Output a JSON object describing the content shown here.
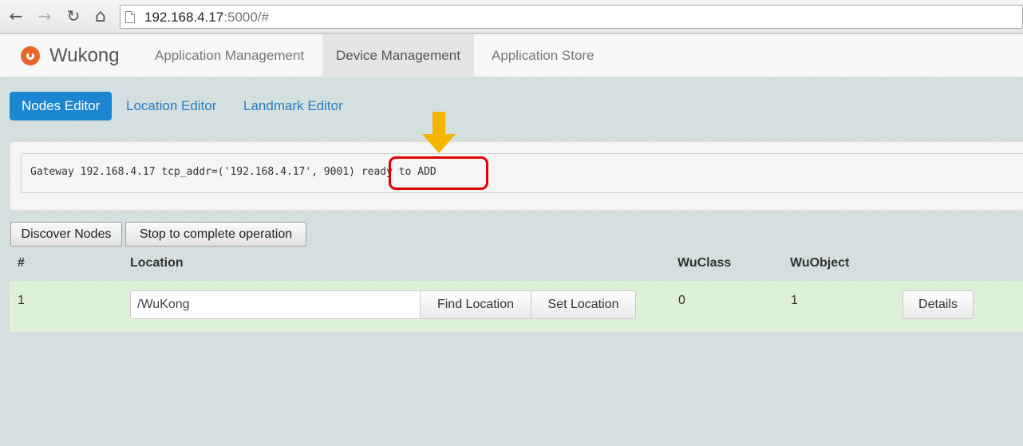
{
  "browser": {
    "url_host": "192.168.4.17",
    "url_rest": ":5000/#",
    "back_icon": "←",
    "forward_icon": "→",
    "reload_icon": "↻",
    "home_icon": "⌂"
  },
  "app": {
    "brand": "Wukong",
    "nav": [
      {
        "label": "Application Management"
      },
      {
        "label": "Device Management",
        "active": true
      },
      {
        "label": "Application Store"
      }
    ]
  },
  "tabs": [
    {
      "label": "Nodes Editor",
      "active": true
    },
    {
      "label": "Location Editor"
    },
    {
      "label": "Landmark Editor"
    }
  ],
  "console": {
    "prefix": "Gateway 192.168.4.17 tcp_addr=('192.168.4.17', 9001)",
    "status": " ready to ADD"
  },
  "actions": {
    "discover_label": "Discover Nodes",
    "stop_label": "Stop to complete operation"
  },
  "table": {
    "headers": [
      "#",
      "Location",
      "WuClass",
      "WuObject"
    ],
    "rows": [
      {
        "index": "1",
        "location": "/WuKong",
        "find_label": "Find Location",
        "set_label": "Set Location",
        "wuclass": "0",
        "wuobject": "1",
        "details_label": "Details"
      }
    ]
  },
  "colors": {
    "accent": "#1b86d2",
    "highlight": "#e00000",
    "arrow": "#f5b400",
    "row_bg": "#dff0d8"
  }
}
